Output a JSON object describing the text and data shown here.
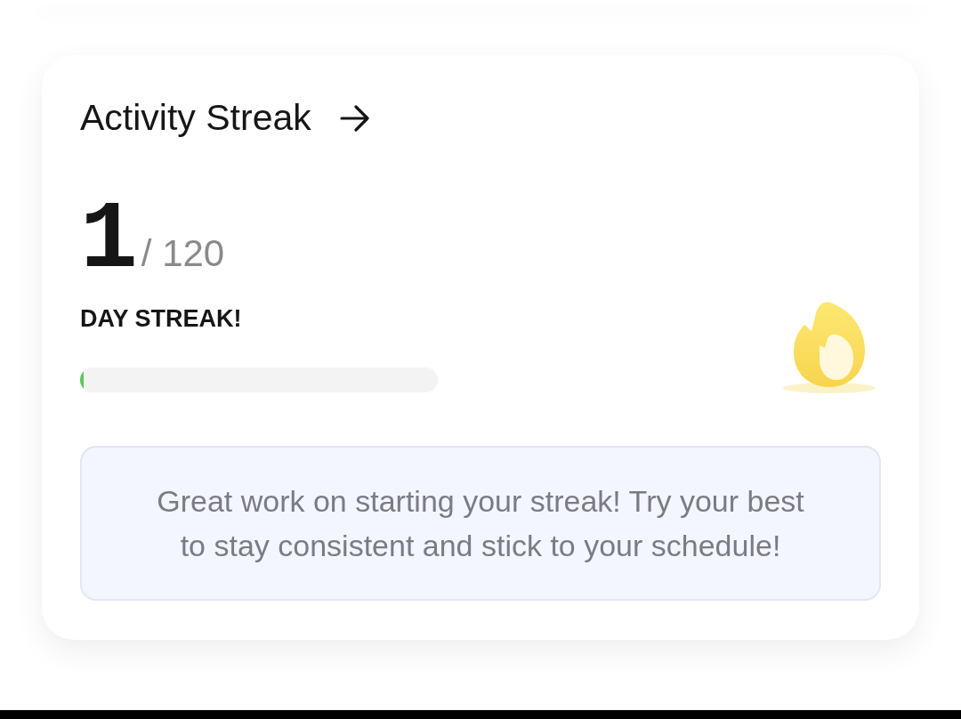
{
  "card": {
    "title": "Activity Streak",
    "streak": {
      "current": "1",
      "total": "/ 120",
      "label": "DAY STREAK!"
    },
    "progress": {
      "level": 0.01
    },
    "message": "Great work on starting your streak! Try your best to stay consistent and stick to your schedule!"
  }
}
